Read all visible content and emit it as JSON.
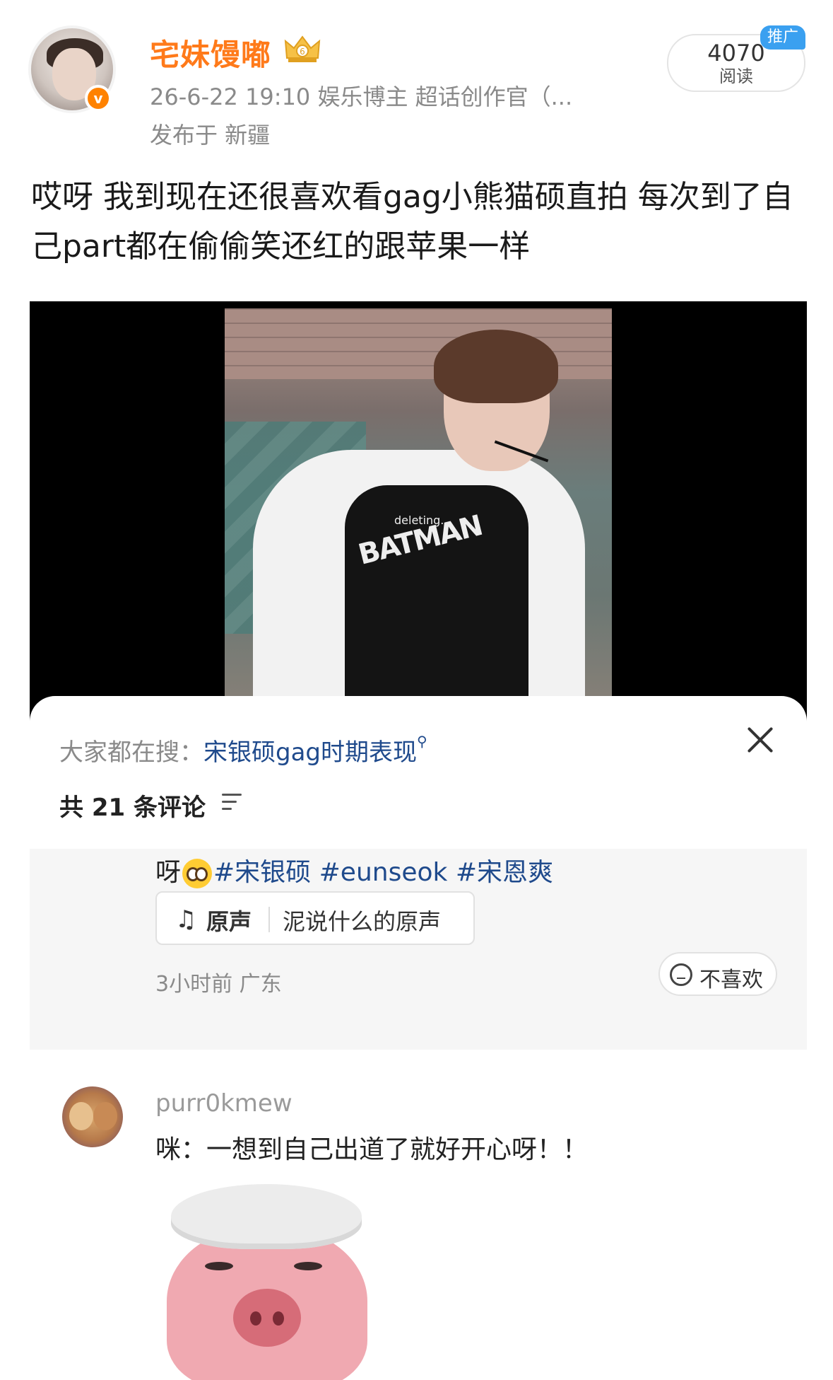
{
  "post": {
    "username": "宅妹馒嘟",
    "meta": "26-6-22 19:10  娱乐博主 超话创作官（...",
    "location": "发布于 新疆",
    "reads_count": "4070",
    "reads_label": "阅读",
    "ad_tag": "推广",
    "text": "哎呀 我到现在还很喜欢看gag小熊猫硕直拍 每次到了自己part都在偷偷笑还红的跟苹果一样"
  },
  "video": {
    "overlay_text": "deleting..."
  },
  "sheet": {
    "search_prefix": "大家都在搜：",
    "search_term": "宋银硕gag时期表现",
    "comment_count": "共 21 条评论"
  },
  "highlighted_comment": {
    "prefix": "呀",
    "tags": [
      "#宋银硕",
      "#eunseok",
      "#宋恩爽"
    ],
    "audio_label": "原声",
    "audio_title": "泥说什么的原声",
    "time_location": "3小时前  广东",
    "dislike_label": "不喜欢"
  },
  "comment2": {
    "username": "purr0kmew",
    "text": "咪：一想到自己出道了就好开心呀！！"
  },
  "colors": {
    "username": "#ff7a1a",
    "link": "#1f4a8c",
    "ad_tag": "#3aa0f0",
    "verified": "#ff8200"
  },
  "icons": [
    "crown-icon",
    "verified-icon",
    "search-icon",
    "close-icon",
    "filter-icon",
    "pleading-emoji-icon",
    "music-note-icon",
    "dislike-face-icon"
  ]
}
